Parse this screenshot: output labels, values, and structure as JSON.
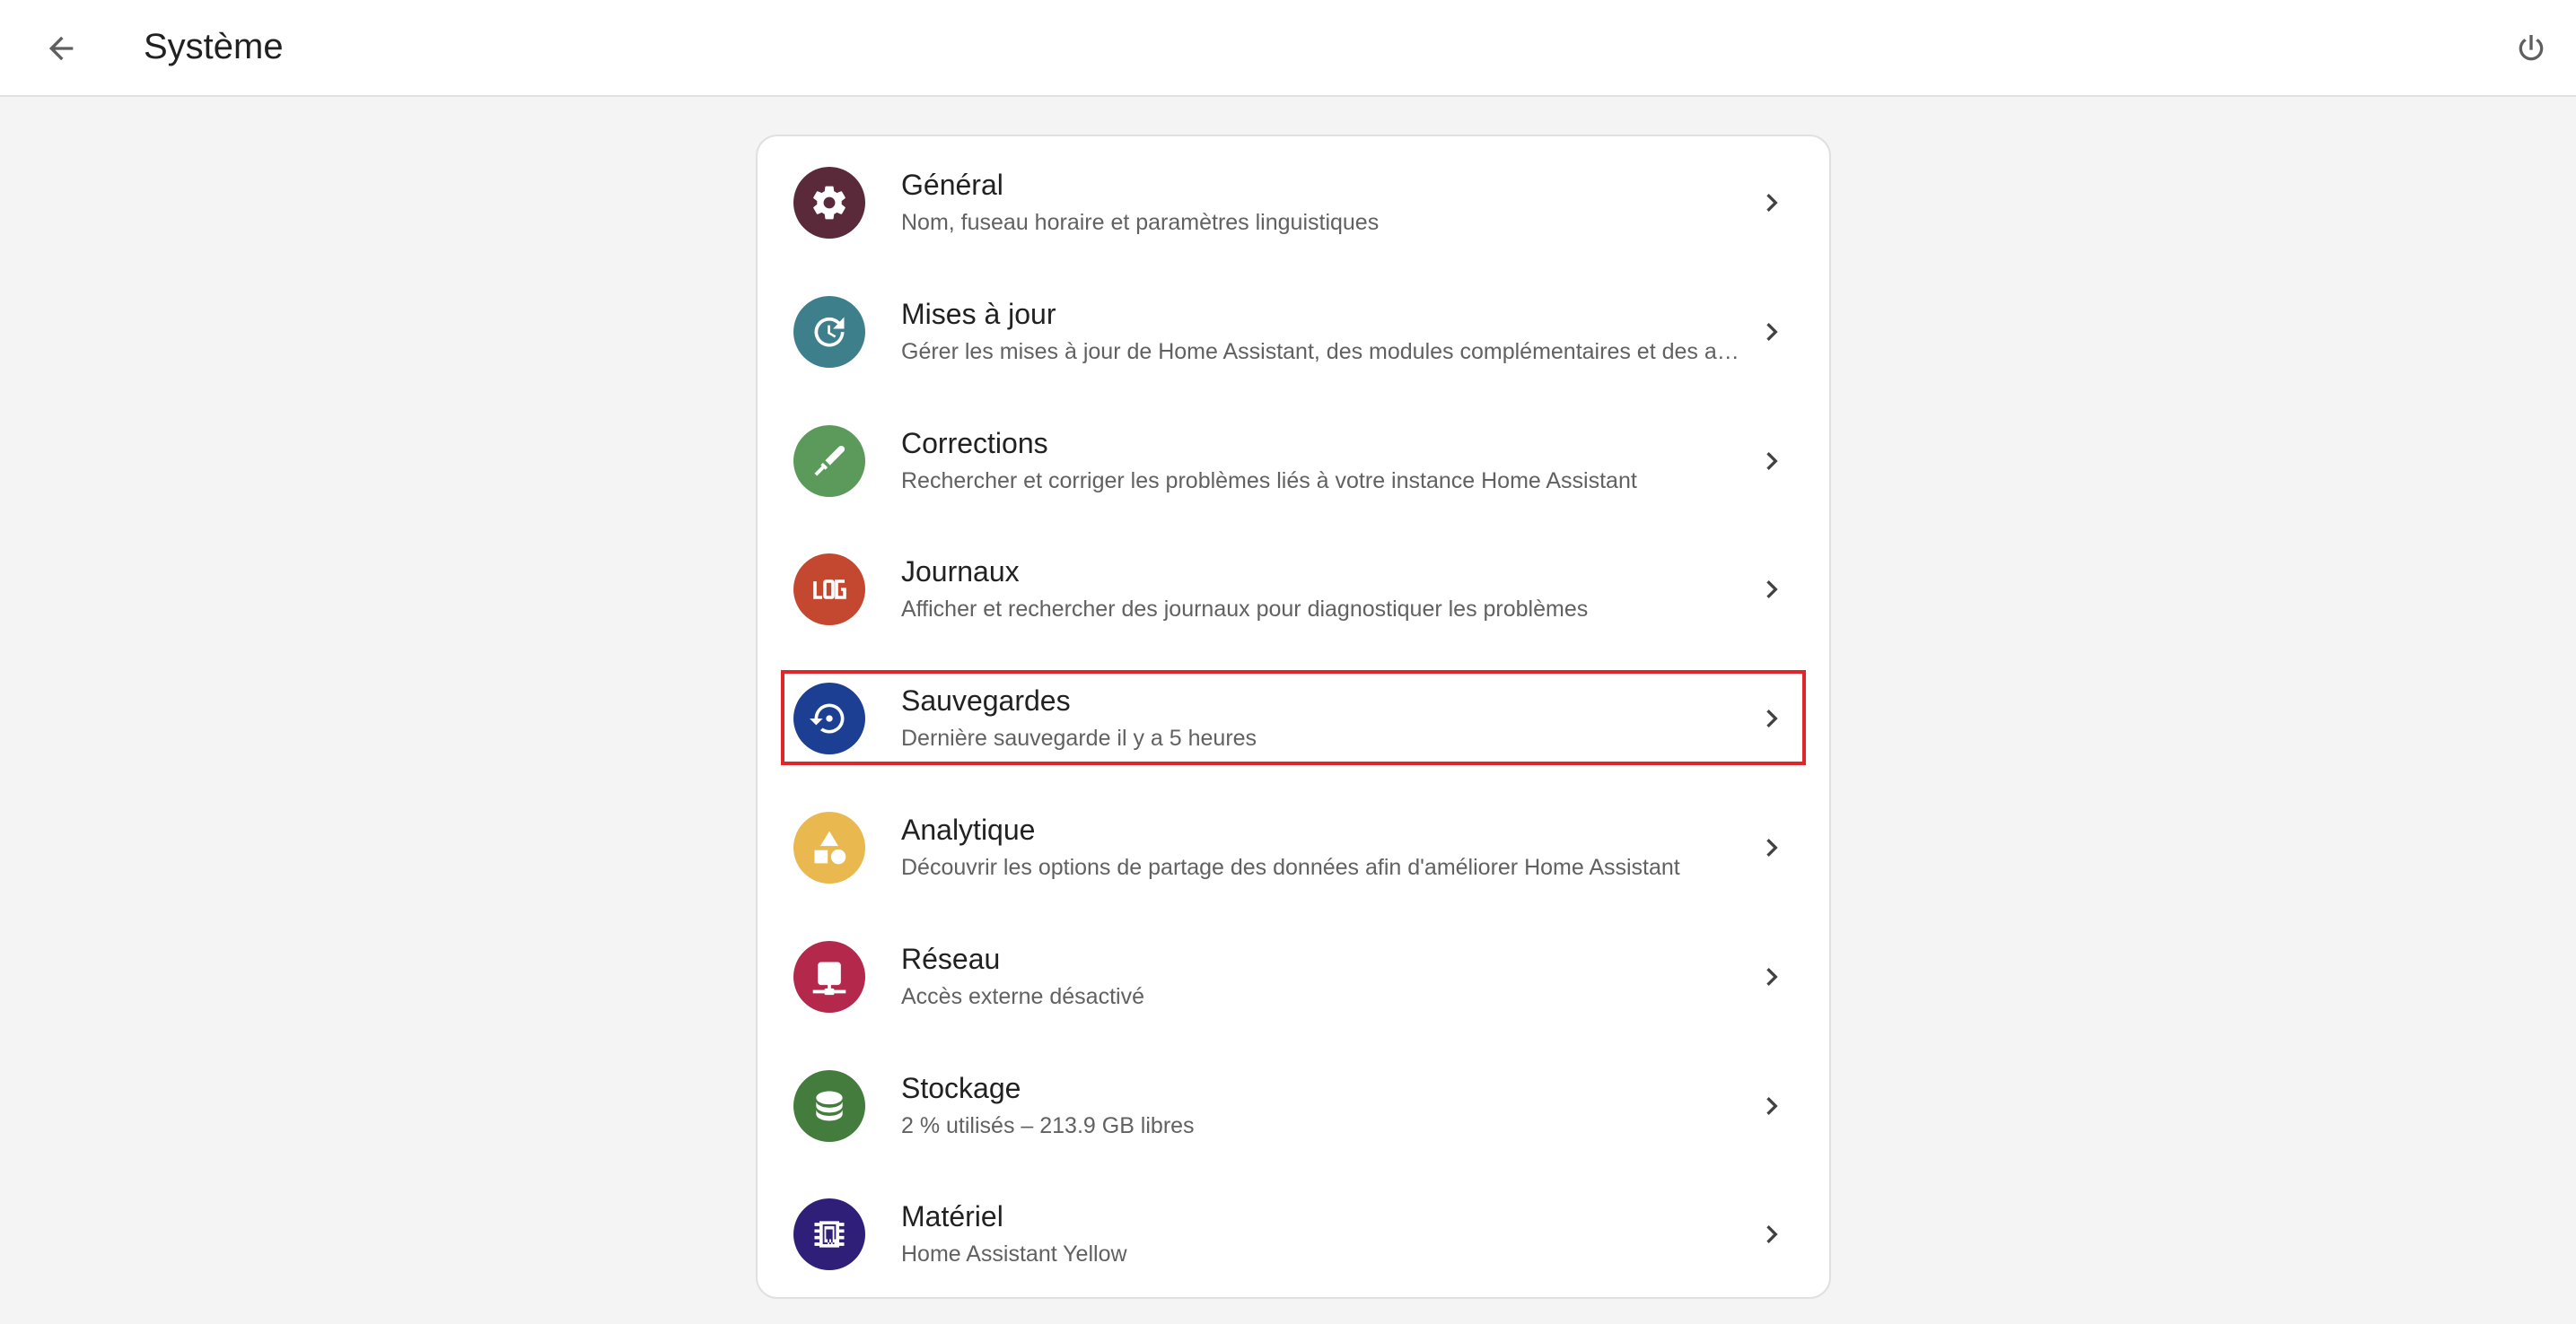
{
  "header": {
    "title": "Système",
    "back_icon": "arrow-left-icon",
    "power_icon": "power-icon"
  },
  "items": [
    {
      "title": "Général",
      "subtitle": "Nom, fuseau horaire et paramètres linguistiques",
      "icon": "gear-icon",
      "color": "#5a2a3b"
    },
    {
      "title": "Mises à jour",
      "subtitle": "Gérer les mises à jour de Home Assistant, des modules complémentaires et des appareils",
      "icon": "update-icon",
      "color": "#3e7f8c"
    },
    {
      "title": "Corrections",
      "subtitle": "Rechercher et corriger les problèmes liés à votre instance Home Assistant",
      "icon": "medical-bag-icon",
      "color": "#5b9a5b"
    },
    {
      "title": "Journaux",
      "subtitle": "Afficher et rechercher des journaux pour diagnostiquer les problèmes",
      "icon": "log-icon",
      "color": "#c4472f"
    },
    {
      "title": "Sauvegardes",
      "subtitle": "Dernière sauvegarde il y a 5 heures",
      "icon": "backup-restore-icon",
      "color": "#1c3f94",
      "highlighted": true
    },
    {
      "title": "Analytique",
      "subtitle": "Découvrir les options de partage des données afin d'améliorer Home Assistant",
      "icon": "shapes-icon",
      "color": "#e9b84e"
    },
    {
      "title": "Réseau",
      "subtitle": "Accès externe désactivé",
      "icon": "network-icon",
      "color": "#b3284b"
    },
    {
      "title": "Stockage",
      "subtitle": "2 % utilisés – 213.9 GB libres",
      "icon": "database-icon",
      "color": "#437c3c"
    },
    {
      "title": "Matériel",
      "subtitle": "Home Assistant Yellow",
      "icon": "chip-icon",
      "color": "#2f1f79"
    }
  ],
  "highlight_color": "#e0262b"
}
